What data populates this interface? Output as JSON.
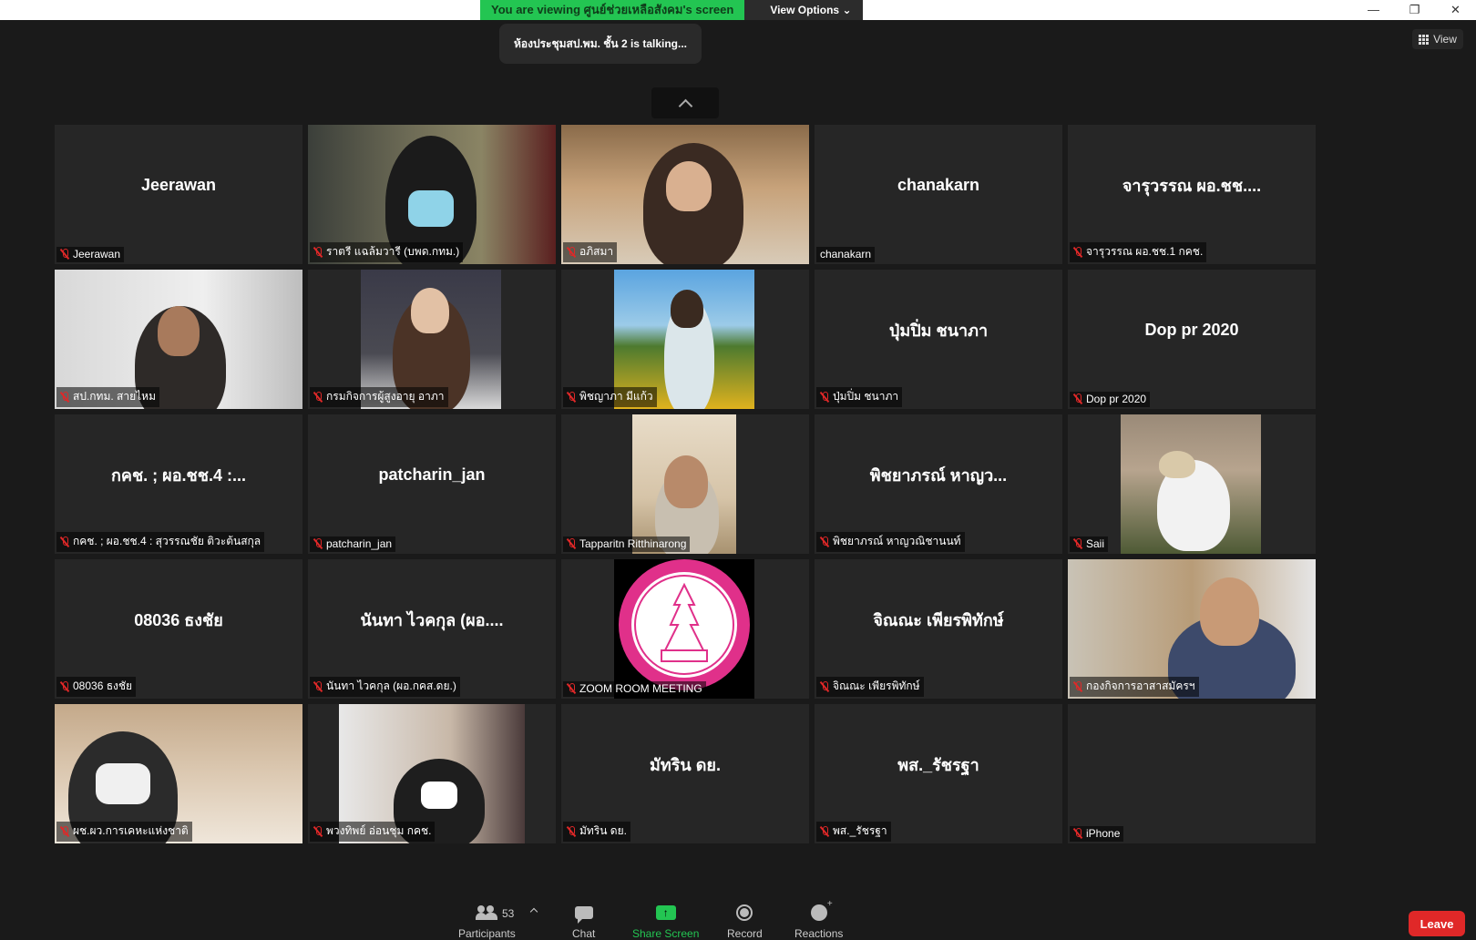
{
  "banner": {
    "viewing_text": "You are viewing ศูนย์ช่วยเหลือสังคม's screen",
    "view_options": "View Options ⌄"
  },
  "window": {
    "minimize": "—",
    "restore": "❐",
    "close": "✕"
  },
  "talking": "ห้องประชุมสป.พม. ชั้น 2 is  talking...",
  "view_button": "View",
  "tiles": [
    {
      "big": "Jeerawan",
      "label": "Jeerawan"
    },
    {
      "big": "",
      "label": "ราตรี แฉล้มวารี (บพด.กทม.)"
    },
    {
      "big": "",
      "label": "อภิสมา"
    },
    {
      "big": "chanakarn",
      "label": "chanakarn"
    },
    {
      "big": "จารุวรรณ  ผอ.ชช....",
      "label": "จารุวรรณ  ผอ.ชช.1 กคช."
    },
    {
      "big": "",
      "label": "สป.กทม. สายไหม"
    },
    {
      "big": "",
      "label": "กรมกิจการผู้สูงอายุ อาภา"
    },
    {
      "big": "",
      "label": "พิชญาภา มีแก้ว"
    },
    {
      "big": "ปุ่มปิ่ม ชนาภา",
      "label": "ปุ่มปิ่ม ชนาภา"
    },
    {
      "big": "Dop pr 2020",
      "label": "Dop pr 2020"
    },
    {
      "big": "กคช. ; ผอ.ชช.4 :...",
      "label": "กคช. ; ผอ.ชช.4 : สุวรรณชัย ติวะต้นสกุล"
    },
    {
      "big": "patcharin_jan",
      "label": "patcharin_jan"
    },
    {
      "big": "",
      "label": "Tapparitn  Ritthinarong"
    },
    {
      "big": "พิชยาภรณ์ หาญว...",
      "label": "พิชยาภรณ์ หาญวณิชานนท์"
    },
    {
      "big": "",
      "label": "Saii"
    },
    {
      "big": "08036 ธงชัย",
      "label": "08036 ธงชัย"
    },
    {
      "big": "นันทา  ไวคกุล (ผอ....",
      "label": "นันทา  ไวคกุล (ผอ.กคส.ดย.)"
    },
    {
      "big": "",
      "label": "ZOOM ROOM MEETING"
    },
    {
      "big": "จิณณะ เพียรพิทักษ์",
      "label": "จิณณะ เพียรพิทักษ์"
    },
    {
      "big": "",
      "label": "กองกิจการอาสาสมัครฯ"
    },
    {
      "big": "",
      "label": "ผช.ผว.การเคหะแห่งชาติ"
    },
    {
      "big": "",
      "label": "พวงทิพย์ อ่อนชุม  กคช."
    },
    {
      "big": "มัทริน ดย.",
      "label": "มัทริน ดย."
    },
    {
      "big": "พส._รัชรฐา",
      "label": "พส._รัชรฐา"
    },
    {
      "big": "",
      "label": "iPhone"
    }
  ],
  "toolbar": {
    "participants_label": "Participants",
    "participants_count": "53",
    "chat_label": "Chat",
    "share_label": "Share Screen",
    "record_label": "Record",
    "reactions_label": "Reactions",
    "leave_label": "Leave"
  },
  "colors": {
    "share_green": "#23c552",
    "leave_red": "#e02828",
    "mute_red": "#e02828"
  }
}
